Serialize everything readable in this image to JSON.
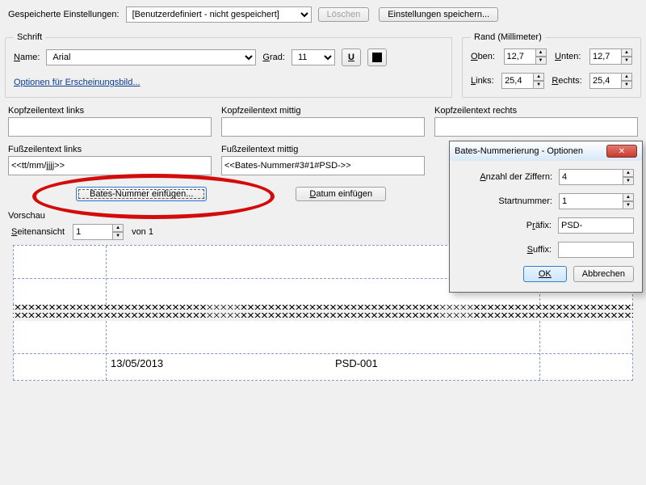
{
  "toolbar": {
    "saved_label": "Gespeicherte Einstellungen:",
    "saved_value": "[Benutzerdefiniert - nicht gespeichert]",
    "delete_label": "Löschen",
    "save_label": "Einstellungen speichern..."
  },
  "font": {
    "legend": "Schrift",
    "name_label": "Name:",
    "name_value": "Arial",
    "size_label": "Grad:",
    "size_value": "11",
    "appearance_link": "Optionen für Erscheinungsbild..."
  },
  "margin": {
    "legend": "Rand (Millimeter)",
    "top_label": "Oben:",
    "top_value": "12,7",
    "bottom_label": "Unten:",
    "bottom_value": "12,7",
    "left_label": "Links:",
    "left_value": "25,4",
    "right_label": "Rechts:",
    "right_value": "25,4"
  },
  "hf": {
    "header_left": "Kopfzeilentext links",
    "header_center": "Kopfzeilentext mittig",
    "header_right": "Kopfzeilentext rechts",
    "footer_left": "Fußzeilentext links",
    "footer_center": "Fußzeilentext mittig",
    "footer_left_value": "<<tt/mm/jjjj>>",
    "footer_center_value": "<<Bates-Nummer#3#1#PSD->>"
  },
  "buttons": {
    "insert_bates": "Bates-Nummer einfügen...",
    "insert_date": "Datum einfügen"
  },
  "preview": {
    "legend": "Vorschau",
    "page_label": "Seitenansicht",
    "page_value": "1",
    "page_of": "von 1",
    "date_text": "13/05/2013",
    "bates_text": "PSD-001"
  },
  "dialog": {
    "title": "Bates-Nummerierung - Optionen",
    "digits_label": "Anzahl der Ziffern:",
    "digits_value": "4",
    "start_label": "Startnummer:",
    "start_value": "1",
    "prefix_label": "Präfix:",
    "prefix_value": "PSD-",
    "suffix_label": "Suffix:",
    "suffix_value": "",
    "ok": "OK",
    "cancel": "Abbrechen"
  }
}
